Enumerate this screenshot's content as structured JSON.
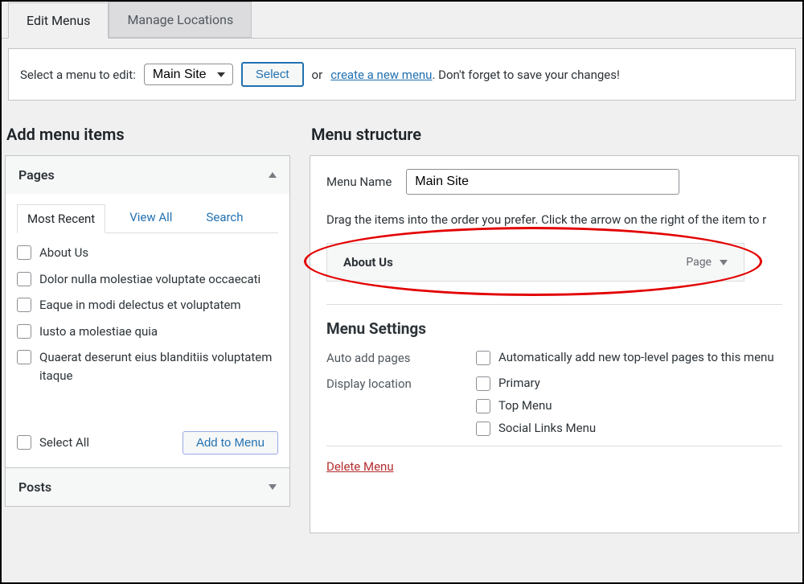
{
  "tabs": {
    "edit": "Edit Menus",
    "manage": "Manage Locations"
  },
  "edit_bar": {
    "label": "Select a menu to edit:",
    "option": "Main Site",
    "select_btn": "Select",
    "or": "or",
    "create_link": "create a new menu",
    "reminder": ". Don't forget to save your changes!"
  },
  "left": {
    "heading": "Add menu items",
    "pages_title": "Pages",
    "posts_title": "Posts",
    "subtabs": {
      "recent": "Most Recent",
      "viewall": "View All",
      "search": "Search"
    },
    "pages": [
      "About Us",
      "Dolor nulla molestiae voluptate occaecati",
      "Eaque in modi delectus et voluptatem",
      "Iusto a molestiae quia",
      "Quaerat deserunt eius blanditiis voluptatem itaque"
    ],
    "select_all": "Select All",
    "add_btn": "Add to Menu"
  },
  "right": {
    "heading": "Menu structure",
    "name_label": "Menu Name",
    "name_value": "Main Site",
    "drag_hint": "Drag the items into the order you prefer. Click the arrow on the right of the item to r",
    "item_title": "About Us",
    "item_type": "Page",
    "settings_heading": "Menu Settings",
    "auto_label": "Auto add pages",
    "auto_option": "Automatically add new top-level pages to this menu",
    "display_label": "Display location",
    "display_options": [
      "Primary",
      "Top Menu",
      "Social Links Menu"
    ],
    "delete": "Delete Menu"
  }
}
